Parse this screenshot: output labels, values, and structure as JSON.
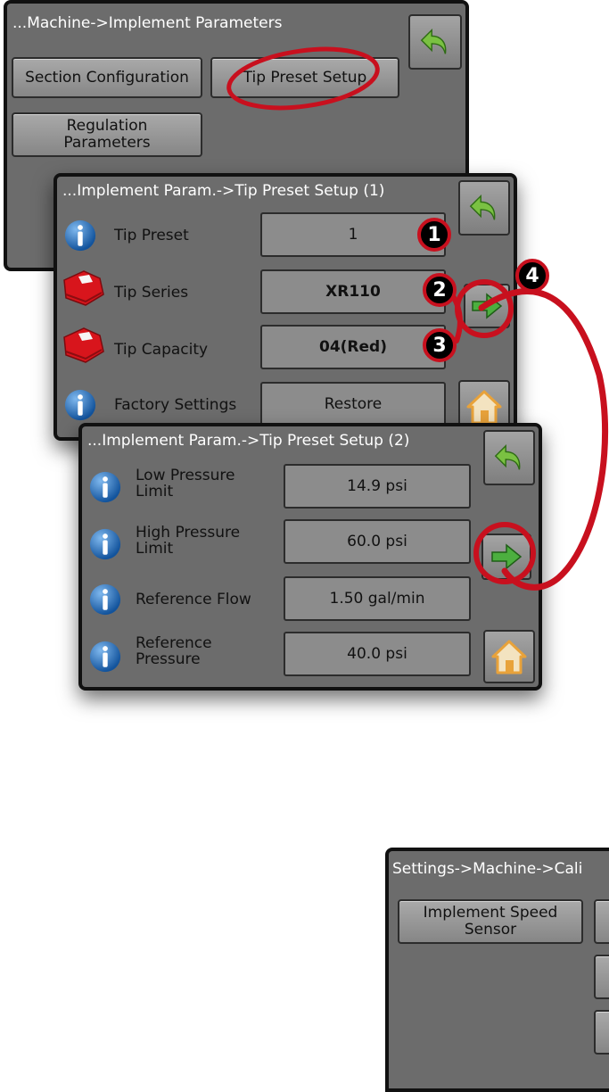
{
  "screen1": {
    "title": "...Machine->Implement Parameters",
    "section_configuration": "Section Configuration",
    "tip_preset_setup": "Tip Preset Setup",
    "regulation_parameters_line1": "Regulation",
    "regulation_parameters_line2": "Parameters"
  },
  "screen2": {
    "title": "...Implement Param.->Tip Preset Setup (1)",
    "rows": [
      {
        "label": "Tip Preset",
        "value": "1"
      },
      {
        "label": "Tip Series",
        "value": "XR110"
      },
      {
        "label": "Tip Capacity",
        "value": "04(Red)"
      },
      {
        "label": "Factory Settings",
        "value": "Restore"
      }
    ]
  },
  "screen3": {
    "title": "...Implement Param.->Tip Preset Setup (2)",
    "rows": [
      {
        "label_line1": "Low Pressure",
        "label_line2": "Limit",
        "value": "14.9 psi"
      },
      {
        "label_line1": "High Pressure",
        "label_line2": "Limit",
        "value": "60.0 psi"
      },
      {
        "label_line1": "Reference Flow",
        "label_line2": "",
        "value": "1.50 gal/min"
      },
      {
        "label_line1": "Reference",
        "label_line2": "Pressure",
        "value": "40.0 psi"
      }
    ]
  },
  "screen4": {
    "title": "Settings->Machine->Cali",
    "implement_speed_sensor_line1": "Implement Speed",
    "implement_speed_sensor_line2": "Sensor"
  },
  "callouts": [
    "1",
    "2",
    "3",
    "4"
  ],
  "colors": {
    "panel_bg": "#6c6c6c",
    "highlight_red": "#c8101e",
    "info_blue": "#1a67b8",
    "back_arrow_green": "#7ac142",
    "next_arrow_green": "#4caf3f",
    "home_orange": "#e8a23a"
  },
  "icons": [
    "info-icon",
    "tip-nozzle-icon",
    "back-arrow-icon",
    "next-arrow-icon",
    "home-icon"
  ]
}
